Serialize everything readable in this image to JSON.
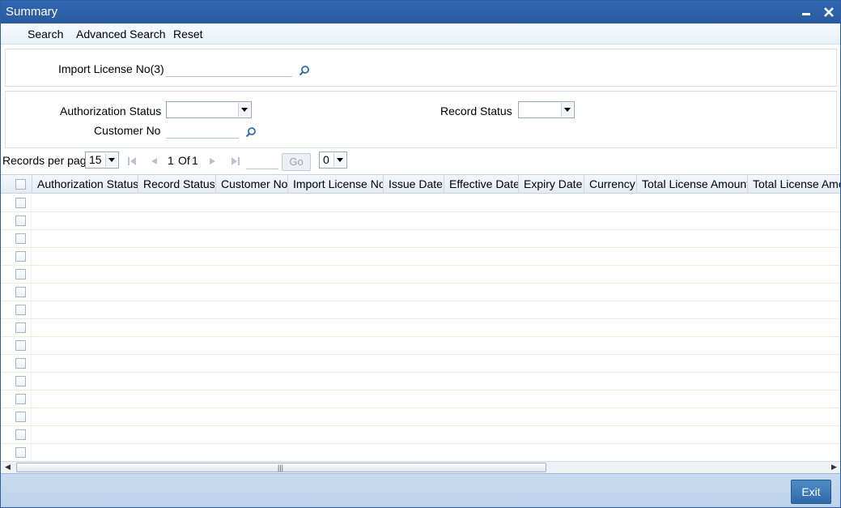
{
  "window": {
    "title": "Summary",
    "minimize_icon": "minimize-icon",
    "close_icon": "close-icon"
  },
  "menu": {
    "search": "Search",
    "advanced_search": "Advanced Search",
    "reset": "Reset"
  },
  "criteria": {
    "import_license_label": "Import License No(3)",
    "import_license_value": "",
    "authorization_status_label": "Authorization Status",
    "authorization_status_value": "",
    "record_status_label": "Record Status",
    "record_status_value": "",
    "customer_no_label": "Customer No",
    "customer_no_value": ""
  },
  "pager": {
    "records_per_page_label": "Records per page",
    "records_per_page_value": "15",
    "current_page": "1",
    "of_label": "Of",
    "total_pages": "1",
    "goto_value": "",
    "go_label": "Go",
    "extra_select_value": "0"
  },
  "grid": {
    "columns": [
      "Authorization Status",
      "Record Status",
      "Customer No",
      "Import License No",
      "Issue Date",
      "Effective Date",
      "Expiry Date",
      "Currency",
      "Total License Amount",
      "Total License Amou"
    ],
    "row_count": 15
  },
  "footer": {
    "exit_label": "Exit"
  },
  "colors": {
    "titlebar": "#2f66b0",
    "footer": "#c9dcef",
    "exit_button": "#3f7bb8"
  }
}
